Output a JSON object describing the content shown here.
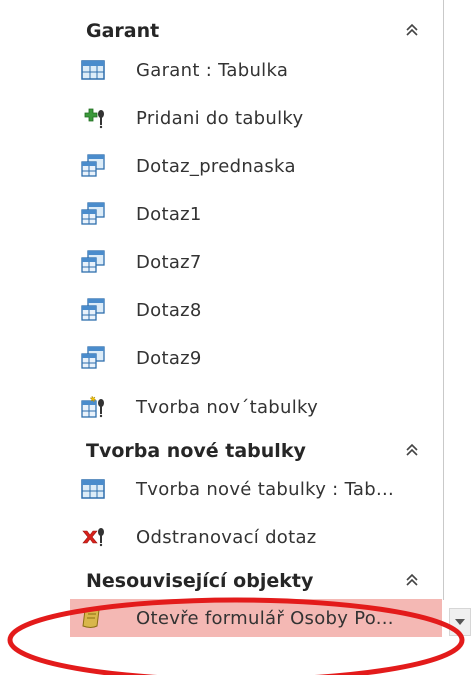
{
  "groups": [
    {
      "title": "Garant",
      "collapse_icon": "double-chevron-up-icon",
      "items": [
        {
          "label": "Garant : Tabulka",
          "icon": "table-icon"
        },
        {
          "label": "Pridani do tabulky",
          "icon": "append-query-icon"
        },
        {
          "label": "Dotaz_prednaska",
          "icon": "select-query-icon"
        },
        {
          "label": "Dotaz1",
          "icon": "select-query-icon"
        },
        {
          "label": "Dotaz7",
          "icon": "select-query-icon"
        },
        {
          "label": "Dotaz8",
          "icon": "select-query-icon"
        },
        {
          "label": "Dotaz9",
          "icon": "select-query-icon"
        },
        {
          "label": "Tvorba nov´tabulky",
          "icon": "make-table-query-icon"
        }
      ]
    },
    {
      "title": "Tvorba nové tabulky",
      "collapse_icon": "double-chevron-up-icon",
      "items": [
        {
          "label": "Tvorba nové tabulky : Tab...",
          "icon": "table-icon"
        },
        {
          "label": "Odstranovací dotaz",
          "icon": "delete-query-icon"
        }
      ]
    },
    {
      "title": "Nesouvisející objekty",
      "collapse_icon": "double-chevron-up-icon",
      "items": [
        {
          "label": "Otevře formulář Osoby Po...",
          "icon": "macro-icon",
          "selected": true
        }
      ]
    }
  ],
  "annotation": {
    "shape": "ellipse",
    "color": "#e31b1b"
  },
  "colors": {
    "selected_bg": "#f4b8b4",
    "annotation": "#e31b1b"
  },
  "scroll": {
    "icon": "scroll-down-arrow-icon"
  }
}
